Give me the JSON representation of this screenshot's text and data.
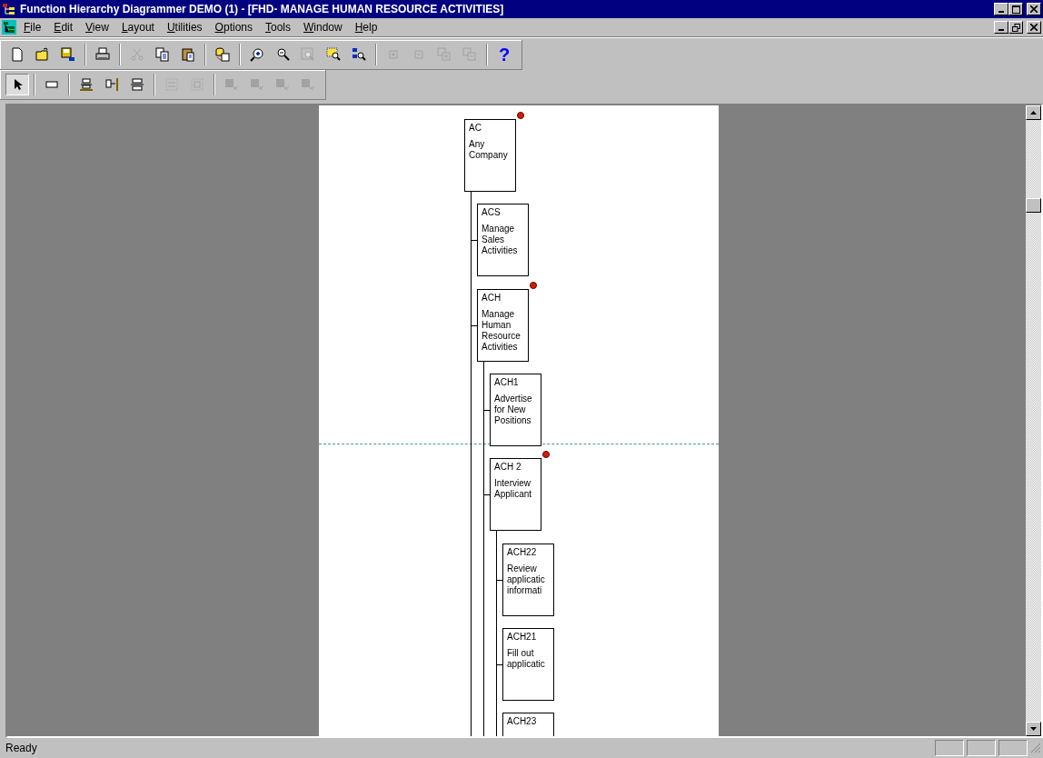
{
  "window": {
    "title": "Function Hierarchy Diagrammer DEMO (1) - [FHD- MANAGE HUMAN RESOURCE ACTIVITIES]"
  },
  "menu": [
    {
      "key": "F",
      "rest": "ile"
    },
    {
      "key": "E",
      "rest": "dit"
    },
    {
      "key": "V",
      "rest": "iew"
    },
    {
      "key": "L",
      "rest": "ayout"
    },
    {
      "key": "U",
      "rest": "tilities"
    },
    {
      "key": "O",
      "rest": "ptions"
    },
    {
      "key": "T",
      "rest": "ools"
    },
    {
      "key": "W",
      "rest": "indow"
    },
    {
      "key": "H",
      "rest": "elp"
    }
  ],
  "toolbars": [
    [
      [
        {
          "kind": "new",
          "disabled": false
        },
        {
          "kind": "open",
          "disabled": false
        },
        {
          "kind": "save",
          "disabled": false
        }
      ],
      [
        {
          "kind": "print",
          "disabled": false
        }
      ],
      [
        {
          "kind": "cut",
          "disabled": true
        },
        {
          "kind": "copy",
          "disabled": false
        },
        {
          "kind": "paste",
          "disabled": false
        }
      ],
      [
        {
          "kind": "database",
          "disabled": false
        }
      ],
      [
        {
          "kind": "zoom-in",
          "disabled": false
        },
        {
          "kind": "zoom-out",
          "disabled": false
        },
        {
          "kind": "zoom-fit",
          "disabled": true
        },
        {
          "kind": "zoom-area",
          "disabled": false
        },
        {
          "kind": "zoom-find",
          "disabled": false
        }
      ],
      [
        {
          "kind": "expand",
          "disabled": true
        },
        {
          "kind": "collapse",
          "disabled": true
        },
        {
          "kind": "expand-all",
          "disabled": true
        },
        {
          "kind": "collapse-all",
          "disabled": true
        }
      ],
      [
        {
          "kind": "help",
          "text": "?",
          "disabled": false
        }
      ]
    ],
    [
      [
        {
          "kind": "pointer",
          "disabled": false,
          "pressed": true
        }
      ],
      [
        {
          "kind": "rectangle",
          "disabled": false,
          "pressed": false
        }
      ],
      [
        {
          "kind": "align-top",
          "disabled": false,
          "pressed": false
        },
        {
          "kind": "align-side",
          "disabled": false,
          "pressed": false
        },
        {
          "kind": "align-middle",
          "disabled": false,
          "pressed": false
        }
      ],
      [
        {
          "kind": "spread",
          "disabled": true,
          "pressed": false
        },
        {
          "kind": "frame",
          "disabled": true,
          "pressed": false
        }
      ],
      [
        {
          "kind": "move-a",
          "disabled": true,
          "pressed": false
        },
        {
          "kind": "move-b",
          "disabled": true,
          "pressed": false
        },
        {
          "kind": "move-c",
          "disabled": true,
          "pressed": false
        },
        {
          "kind": "move-d",
          "disabled": true,
          "pressed": false
        }
      ]
    ]
  ],
  "diagram": {
    "nodes": [
      {
        "code": "AC",
        "name": "Any Company",
        "marked": true,
        "children": [
          {
            "code": "ACS",
            "name": "Manage Sales Activities",
            "marked": false
          },
          {
            "code": "ACH",
            "name": "Manage Human Resource Activities",
            "marked": true,
            "children": [
              {
                "code": "ACH1",
                "name": "Advertise for New Positions",
                "marked": false
              },
              {
                "code": "ACH 2",
                "name": "Interview Applicant",
                "marked": true,
                "children": [
                  {
                    "code": "ACH22",
                    "name": "Review applicatic informati",
                    "marked": false
                  },
                  {
                    "code": "ACH21",
                    "name": "Fill out applicatic",
                    "marked": false
                  },
                  {
                    "code": "ACH23",
                    "marked": false
                  }
                ]
              }
            ]
          }
        ]
      }
    ]
  },
  "status_bar": {
    "text": "Ready"
  }
}
